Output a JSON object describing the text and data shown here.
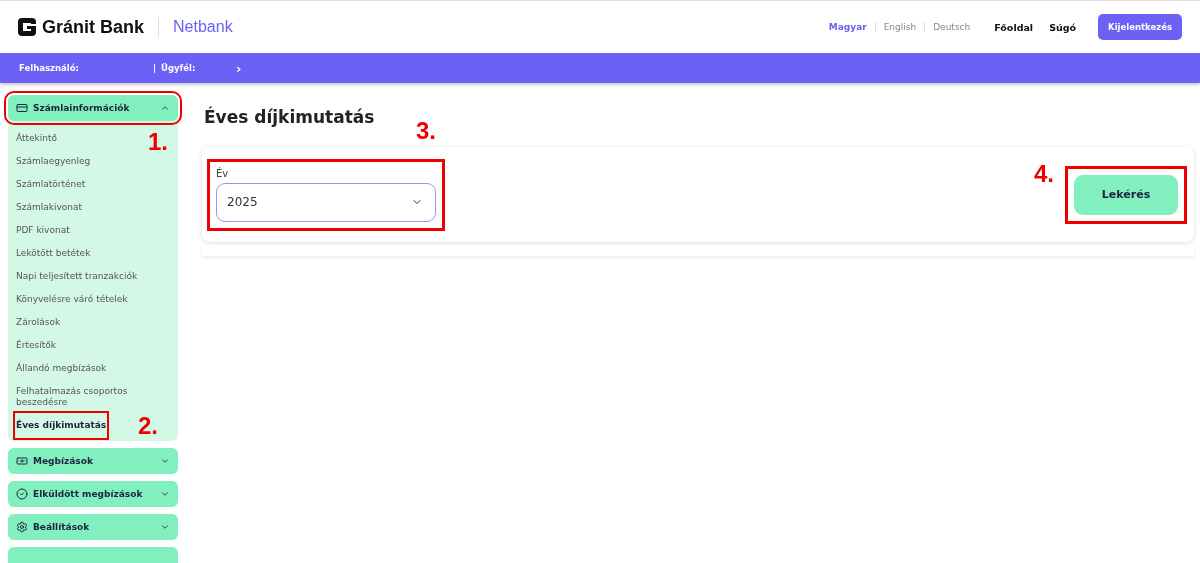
{
  "header": {
    "brand": "Gránit Bank",
    "product": "Netbank",
    "languages": [
      {
        "label": "Magyar",
        "selected": true
      },
      {
        "label": "English",
        "selected": false
      },
      {
        "label": "Deutsch",
        "selected": false
      }
    ],
    "links": [
      "Főoldal",
      "Súgó"
    ],
    "logout": "Kijelentkezés"
  },
  "info_bar": {
    "user_label": "Felhasználó:",
    "separator": "|",
    "client_label": "Ügyfél:",
    "arrow": "›"
  },
  "sidebar": {
    "sections": [
      {
        "kind": "card",
        "label": "Számlainformációk",
        "expanded": true,
        "highlighted": true,
        "step": "1.",
        "items": [
          {
            "label": "Áttekintő",
            "selected": false,
            "highlighted": false
          },
          {
            "label": "Számlaegyenleg",
            "selected": false,
            "highlighted": false
          },
          {
            "label": "Számlatörténet",
            "selected": false,
            "highlighted": false
          },
          {
            "label": "Számlakivonat",
            "selected": false,
            "highlighted": false
          },
          {
            "label": "PDF kivonat",
            "selected": false,
            "highlighted": false
          },
          {
            "label": "Lekötött betétek",
            "selected": false,
            "highlighted": false
          },
          {
            "label": "Napi teljesített tranzakciók",
            "selected": false,
            "highlighted": false
          },
          {
            "label": "Könyvelésre váró tételek",
            "selected": false,
            "highlighted": false
          },
          {
            "label": "Zárolások",
            "selected": false,
            "highlighted": false
          },
          {
            "label": "Értesítők",
            "selected": false,
            "highlighted": false
          },
          {
            "label": "Állandó megbízások",
            "selected": false,
            "highlighted": false
          },
          {
            "label": "Felhatalmazás csoportos beszedésre",
            "selected": false,
            "highlighted": false
          },
          {
            "label": "Éves díjkimutatás",
            "selected": true,
            "highlighted": true,
            "step": "2."
          }
        ]
      },
      {
        "kind": "money",
        "label": "Megbízások",
        "expanded": false,
        "highlighted": false
      },
      {
        "kind": "check",
        "label": "Elküldött megbízások",
        "expanded": false,
        "highlighted": false
      },
      {
        "kind": "gear",
        "label": "Beállítások",
        "expanded": false,
        "highlighted": false
      },
      {
        "kind": "blank",
        "expanded": false,
        "highlighted": false
      }
    ]
  },
  "main": {
    "title": "Éves díjkimutatás",
    "year_field": {
      "label": "Év",
      "value": "2025",
      "highlighted": true,
      "step": "3."
    },
    "submit": {
      "label": "Lekérés",
      "highlighted": true,
      "step": "4."
    }
  }
}
